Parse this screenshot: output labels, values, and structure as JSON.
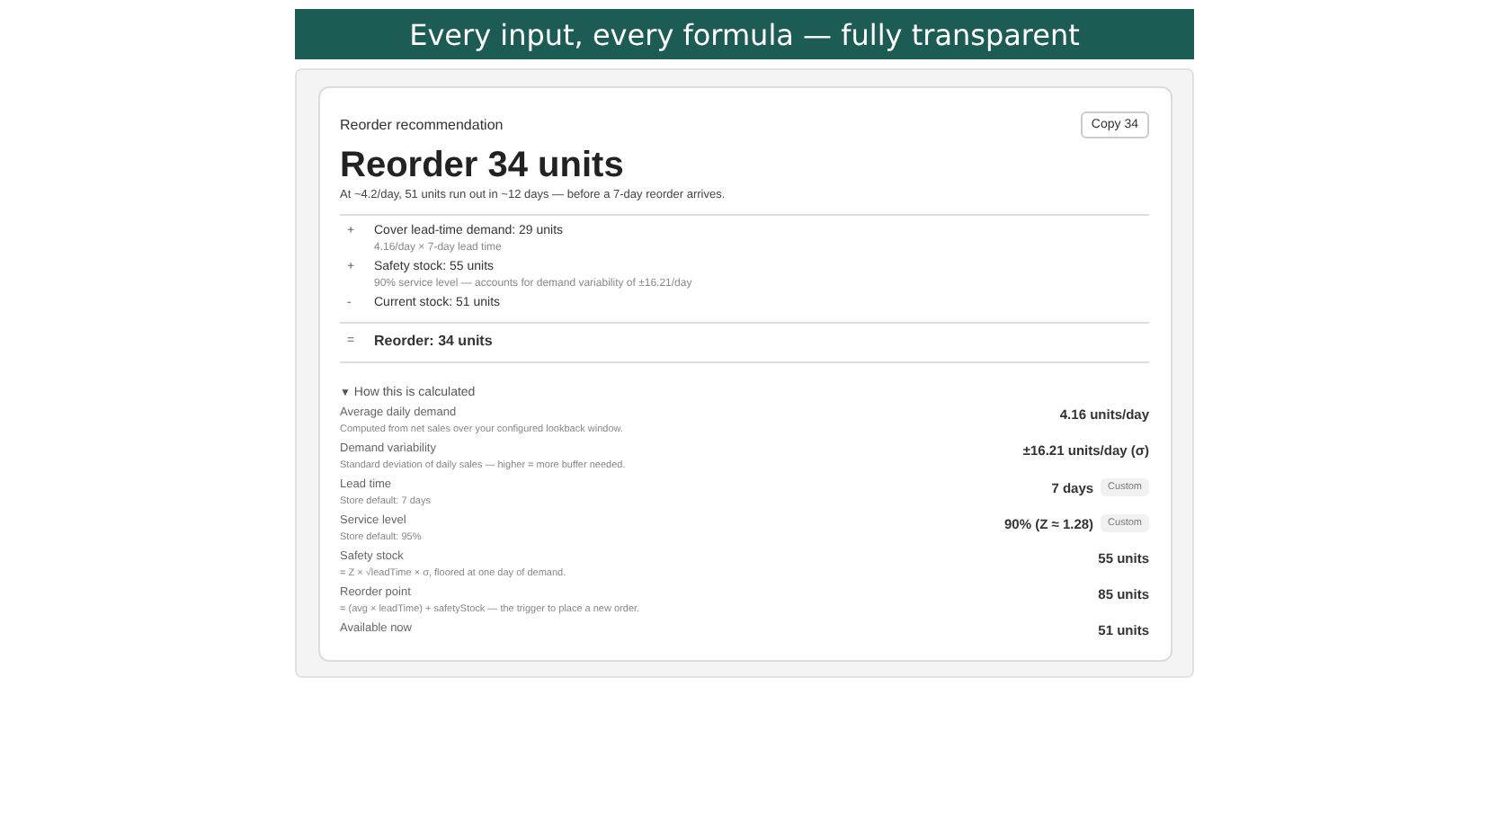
{
  "banner": {
    "title": "Every input, every formula — fully transparent"
  },
  "card": {
    "title": "Reorder recommendation",
    "copy_button": "Copy 34",
    "headline": "Reorder 34 units",
    "summary": "At ~4.2/day, 51 units run out in ~12 days — before a 7-day reorder arrives.",
    "steps": [
      {
        "sign": "+",
        "label": "Cover lead-time demand: 29 units",
        "detail": "4.16/day × 7-day lead time"
      },
      {
        "sign": "+",
        "label": "Safety stock: 55 units",
        "detail": "90% service level — accounts for demand variability of ±16.21/day"
      },
      {
        "sign": "-",
        "label": "Current stock: 51 units"
      }
    ],
    "result": {
      "sign": "=",
      "label": "Reorder: 34 units"
    },
    "details": {
      "toggle": "▼",
      "label": "How this is calculated",
      "expanded": true,
      "rows": [
        {
          "label": "Average daily demand",
          "note": "Computed from net sales over your configured lookback window.",
          "value": "4.16 units/day"
        },
        {
          "label": "Demand variability",
          "note": "Standard deviation of daily sales — higher = more buffer needed.",
          "value": "±16.21 units/day (σ)"
        },
        {
          "label": "Lead time",
          "note": "Store default: 7 days",
          "value": "7 days",
          "badge": "Custom"
        },
        {
          "label": "Service level",
          "note": "Store default: 95%",
          "value": "90% (Z ≈ 1.28)",
          "badge": "Custom"
        },
        {
          "label": "Safety stock",
          "note": "= Z × √leadTime × σ, floored at one day of demand.",
          "value": "55 units"
        },
        {
          "label": "Reorder point",
          "note": "= (avg × leadTime) + safetyStock — the trigger to place a new order.",
          "value": "85 units"
        },
        {
          "label": "Available now",
          "value": "51 units"
        }
      ]
    }
  }
}
